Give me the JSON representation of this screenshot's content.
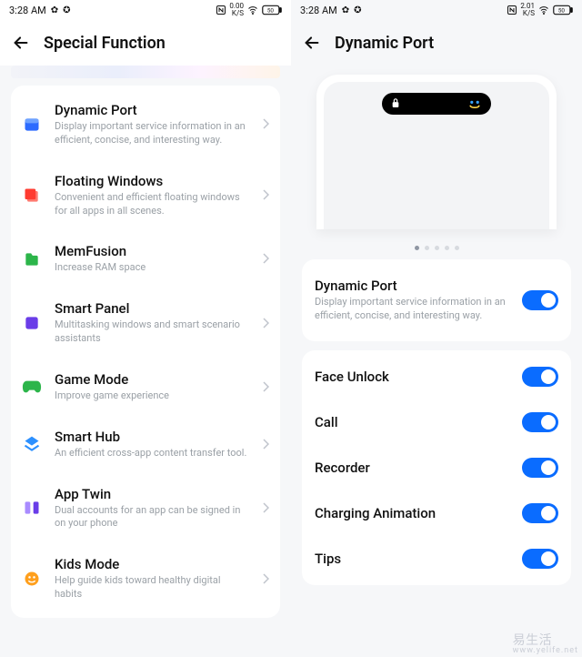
{
  "left": {
    "status": {
      "time": "3:28 AM",
      "net_speed_top": "0.00",
      "net_speed_unit": "K/S"
    },
    "title": "Special Function",
    "items": [
      {
        "title": "Dynamic Port",
        "desc": "Display important service information in an efficient, concise, and interesting way.",
        "icon": "blue-card"
      },
      {
        "title": "Floating Windows",
        "desc": "Convenient and efficient floating windows for all apps in all scenes.",
        "icon": "red-stack"
      },
      {
        "title": "MemFusion",
        "desc": "Increase RAM space",
        "icon": "green-folder"
      },
      {
        "title": "Smart Panel",
        "desc": "Multitasking windows and smart scenario assistants",
        "icon": "purple-tile"
      },
      {
        "title": "Game Mode",
        "desc": "Improve game experience",
        "icon": "green-gamepad"
      },
      {
        "title": "Smart Hub",
        "desc": "An efficient cross-app content transfer tool.",
        "icon": "blue-diamond"
      },
      {
        "title": "App Twin",
        "desc": "Dual accounts for an app can be signed in on your phone",
        "icon": "purple-pair"
      },
      {
        "title": "Kids Mode",
        "desc": "Help guide kids toward healthy digital habits",
        "icon": "orange-kid"
      }
    ]
  },
  "right": {
    "status": {
      "time": "3:28 AM",
      "net_speed_top": "2.01",
      "net_speed_unit": "K/S"
    },
    "title": "Dynamic Port",
    "hero": {
      "title": "Dynamic Port",
      "desc": "Display important service information in an efficient, concise, and interesting way."
    },
    "toggles": [
      {
        "label": "Face Unlock"
      },
      {
        "label": "Call"
      },
      {
        "label": "Recorder"
      },
      {
        "label": "Charging Animation"
      },
      {
        "label": "Tips"
      }
    ]
  },
  "watermark": {
    "main": "易生活",
    "sub": "www.yelife.net"
  }
}
